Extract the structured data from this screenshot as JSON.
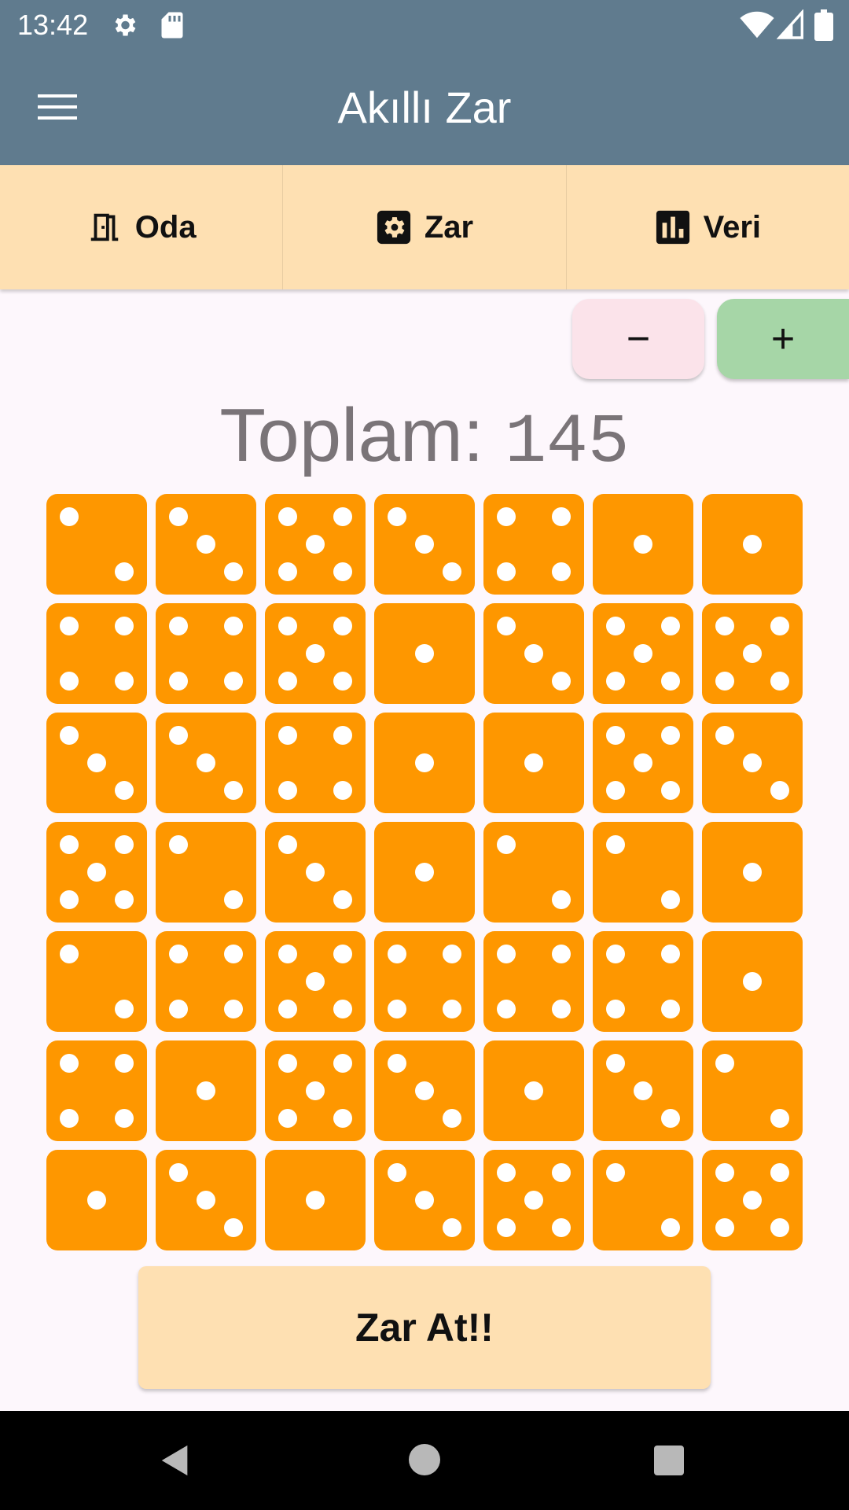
{
  "status_bar": {
    "time": "13:42",
    "icons": [
      "gear-icon",
      "sd-card-icon",
      "wifi-icon",
      "signal-icon",
      "battery-icon"
    ]
  },
  "app_bar": {
    "title": "Akıllı Zar",
    "menu_icon": "menu-icon"
  },
  "tabs": [
    {
      "label": "Oda",
      "icon": "door-icon"
    },
    {
      "label": "Zar",
      "icon": "die-settings-icon"
    },
    {
      "label": "Veri",
      "icon": "bar-chart-icon"
    }
  ],
  "controls": {
    "minus_label": "−",
    "plus_label": "+"
  },
  "total": {
    "label": "Toplam:",
    "value": "145"
  },
  "dice": [
    [
      2,
      3,
      5,
      3,
      4,
      1,
      1
    ],
    [
      4,
      4,
      5,
      1,
      3,
      5,
      5
    ],
    [
      3,
      3,
      4,
      1,
      1,
      5,
      3
    ],
    [
      5,
      2,
      3,
      1,
      2,
      2,
      1
    ],
    [
      2,
      4,
      5,
      4,
      4,
      4,
      1
    ],
    [
      4,
      1,
      5,
      3,
      1,
      3,
      2
    ],
    [
      1,
      3,
      1,
      3,
      5,
      2,
      5
    ]
  ],
  "roll_button": {
    "label": "Zar At!!"
  },
  "colors": {
    "app_bar": "#607b8e",
    "tab_bar": "#fee0b2",
    "die": "#fe9700",
    "pip": "#ffffff",
    "minus_button": "#fbe3ea",
    "plus_button": "#a6d6a7",
    "total_text": "#7a7478",
    "background": "#fdf7fc"
  },
  "nav_bar": {
    "icons": [
      "back-icon",
      "home-icon",
      "recents-icon"
    ]
  }
}
